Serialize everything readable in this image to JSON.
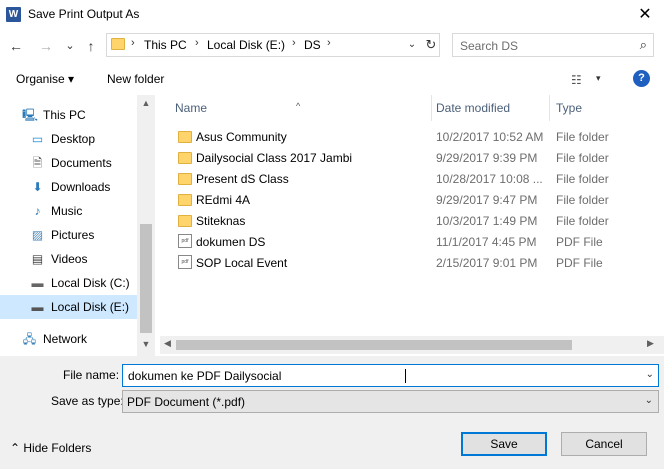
{
  "window": {
    "title": "Save Print Output As",
    "app_icon": "W",
    "close_glyph": "✕"
  },
  "nav": {
    "back": "←",
    "forward": "→",
    "recent": "⌄",
    "up": "↑"
  },
  "address": {
    "crumbs": [
      "This PC",
      "Local Disk (E:)",
      "DS"
    ],
    "sep": "›",
    "dropdown": "⌄",
    "refresh": "↻"
  },
  "search": {
    "placeholder": "Search DS",
    "icon": "⌕"
  },
  "toolbar": {
    "organise": "Organise ▾",
    "new_folder": "New folder",
    "view_icon": "☷",
    "view_drop": "▾",
    "help": "?"
  },
  "sidebar": {
    "items": [
      {
        "label": "This PC",
        "icon": "this-pc-icon",
        "glyph": "🖳"
      },
      {
        "label": "Desktop",
        "icon": "desktop-icon",
        "glyph": "▭"
      },
      {
        "label": "Documents",
        "icon": "documents-icon",
        "glyph": "🗎"
      },
      {
        "label": "Downloads",
        "icon": "downloads-icon",
        "glyph": "⬇"
      },
      {
        "label": "Music",
        "icon": "music-icon",
        "glyph": "♪"
      },
      {
        "label": "Pictures",
        "icon": "pictures-icon",
        "glyph": "▨"
      },
      {
        "label": "Videos",
        "icon": "videos-icon",
        "glyph": "▤"
      },
      {
        "label": "Local Disk (C:)",
        "icon": "drive-c-icon",
        "glyph": "▬"
      },
      {
        "label": "Local Disk (E:)",
        "icon": "drive-e-icon",
        "glyph": "▬"
      },
      {
        "label": "Network",
        "icon": "network-icon",
        "glyph": "🖧"
      }
    ],
    "scroll_up": "▲",
    "scroll_down": "▼"
  },
  "columns": {
    "name": "Name",
    "date": "Date modified",
    "type": "Type",
    "sort_arrow": "^"
  },
  "files": [
    {
      "name": "Asus Community",
      "date": "10/2/2017 10:52 AM",
      "type": "File folder",
      "kind": "folder"
    },
    {
      "name": "Dailysocial Class 2017 Jambi",
      "date": "9/29/2017 9:39 PM",
      "type": "File folder",
      "kind": "folder"
    },
    {
      "name": "Present dS Class",
      "date": "10/28/2017 10:08 ...",
      "type": "File folder",
      "kind": "folder"
    },
    {
      "name": "REdmi 4A",
      "date": "9/29/2017 9:47 PM",
      "type": "File folder",
      "kind": "folder"
    },
    {
      "name": "Stiteknas",
      "date": "10/3/2017 1:49 PM",
      "type": "File folder",
      "kind": "folder"
    },
    {
      "name": "dokumen DS",
      "date": "11/1/2017 4:45 PM",
      "type": "PDF File",
      "kind": "pdf"
    },
    {
      "name": "SOP Local Event",
      "date": "2/15/2017 9:01 PM",
      "type": "PDF File",
      "kind": "pdf"
    }
  ],
  "pdf_icon_text": "pdf",
  "hscroll": {
    "left": "◀",
    "right": "▶"
  },
  "form": {
    "filename_label": "File name:",
    "filename_value": "dokumen ke PDF Dailysocial",
    "savetype_label": "Save as type:",
    "savetype_value": "PDF Document (*.pdf)",
    "dropdown": "⌄"
  },
  "footer": {
    "hide_folders": "⌃  Hide Folders",
    "save": "Save",
    "cancel": "Cancel"
  },
  "colors": {
    "accent": "#0078d7",
    "selected_bg": "#cde8ff",
    "folder": "#ffd56b"
  }
}
